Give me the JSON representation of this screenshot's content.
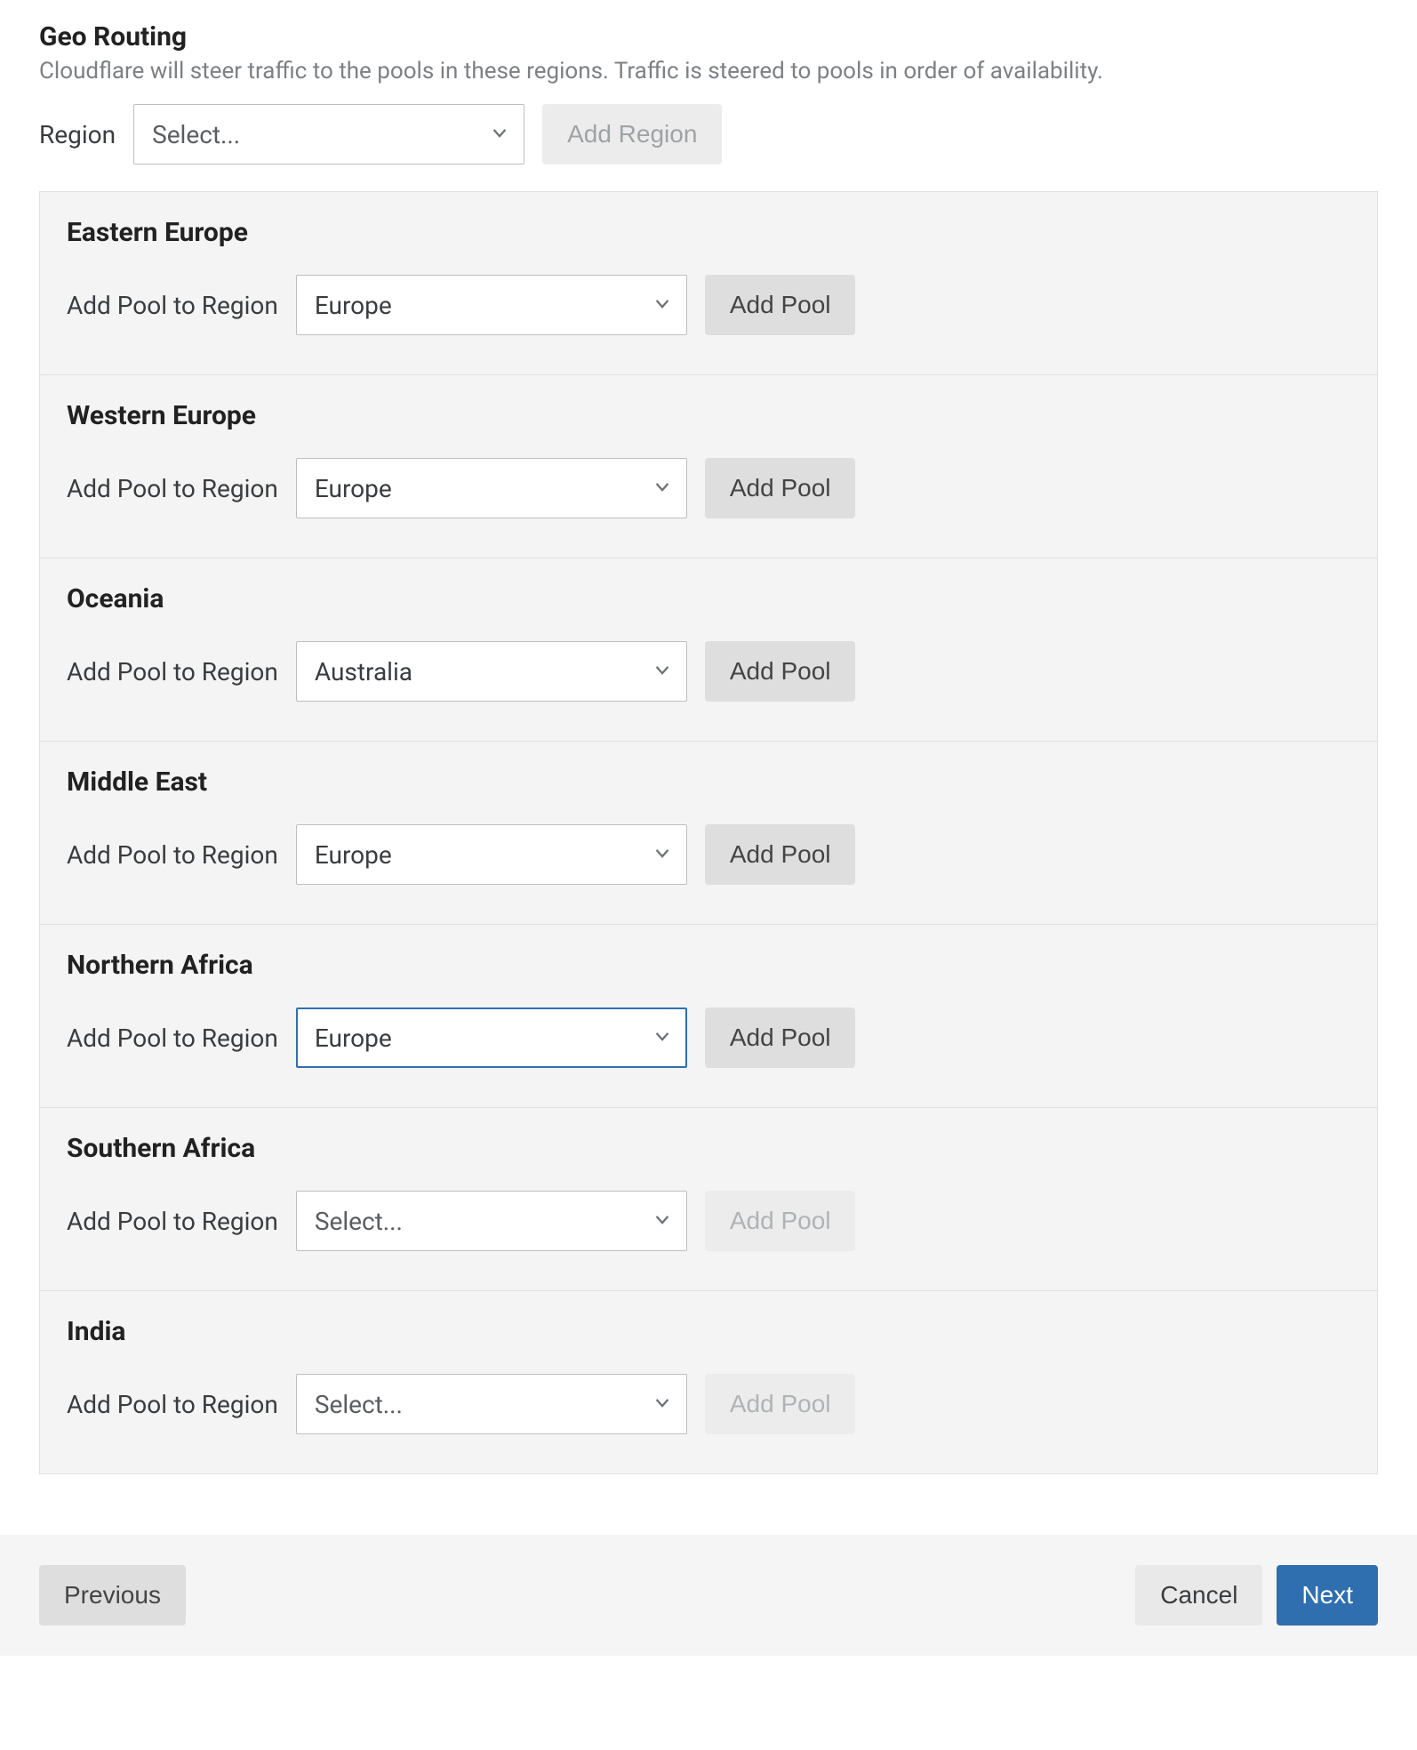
{
  "header": {
    "title": "Geo Routing",
    "subtitle": "Cloudflare will steer traffic to the pools in these regions. Traffic is steered to pools in order of availability."
  },
  "topbar": {
    "region_label": "Region",
    "region_select_value": "Select...",
    "add_region_label": "Add Region"
  },
  "common": {
    "add_pool_to_region_label": "Add Pool to Region",
    "add_pool_label": "Add Pool"
  },
  "regions": [
    {
      "name": "Eastern Europe",
      "pool_value": "Europe",
      "is_placeholder": false,
      "add_disabled": false,
      "focused": false
    },
    {
      "name": "Western Europe",
      "pool_value": "Europe",
      "is_placeholder": false,
      "add_disabled": false,
      "focused": false
    },
    {
      "name": "Oceania",
      "pool_value": "Australia",
      "is_placeholder": false,
      "add_disabled": false,
      "focused": false
    },
    {
      "name": "Middle East",
      "pool_value": "Europe",
      "is_placeholder": false,
      "add_disabled": false,
      "focused": false
    },
    {
      "name": "Northern Africa",
      "pool_value": "Europe",
      "is_placeholder": false,
      "add_disabled": false,
      "focused": true
    },
    {
      "name": "Southern Africa",
      "pool_value": "Select...",
      "is_placeholder": true,
      "add_disabled": true,
      "focused": false
    },
    {
      "name": "India",
      "pool_value": "Select...",
      "is_placeholder": true,
      "add_disabled": true,
      "focused": false
    }
  ],
  "footer": {
    "previous_label": "Previous",
    "cancel_label": "Cancel",
    "next_label": "Next"
  }
}
